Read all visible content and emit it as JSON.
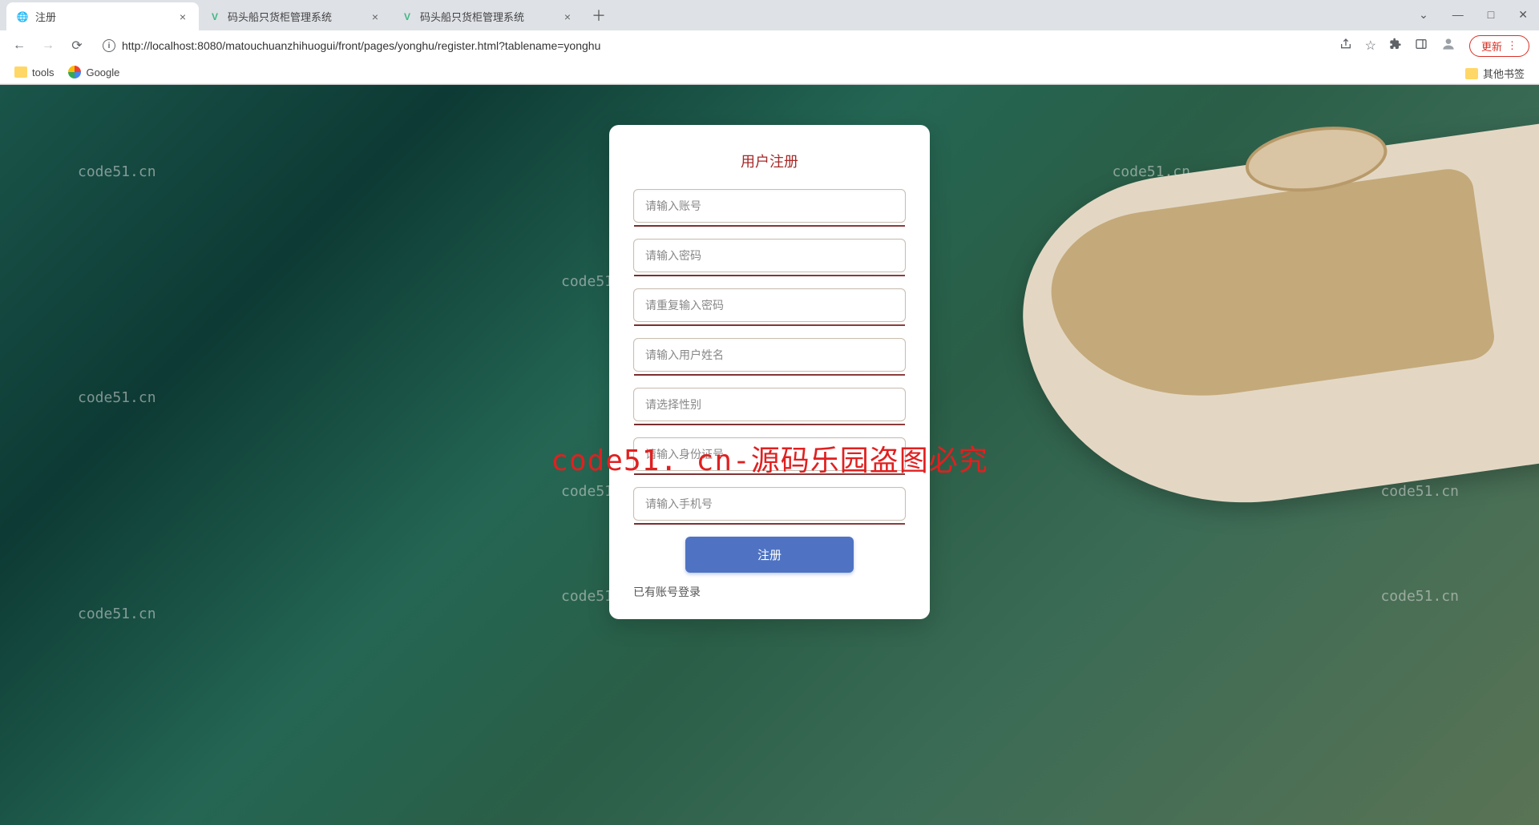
{
  "browser": {
    "tabs": [
      {
        "title": "注册",
        "active": true,
        "icon": "globe"
      },
      {
        "title": "码头船只货柜管理系统",
        "active": false,
        "icon": "vue"
      },
      {
        "title": "码头船只货柜管理系统",
        "active": false,
        "icon": "vue"
      }
    ],
    "url": "http://localhost:8080/matouchuanzhihuogui/front/pages/yonghu/register.html?tablename=yonghu",
    "update_label": "更新",
    "bookmarks": {
      "tools": "tools",
      "google": "Google",
      "other": "其他书签"
    }
  },
  "form": {
    "title": "用户注册",
    "account_placeholder": "请输入账号",
    "password_placeholder": "请输入密码",
    "password2_placeholder": "请重复输入密码",
    "name_placeholder": "请输入用户姓名",
    "gender_placeholder": "请选择性别",
    "idcard_placeholder": "请输入身份证号",
    "phone_placeholder": "请输入手机号",
    "submit_label": "注册",
    "login_link": "已有账号登录"
  },
  "watermark": {
    "main": "code51. cn-源码乐园盗图必究",
    "small": "code51.cn"
  }
}
